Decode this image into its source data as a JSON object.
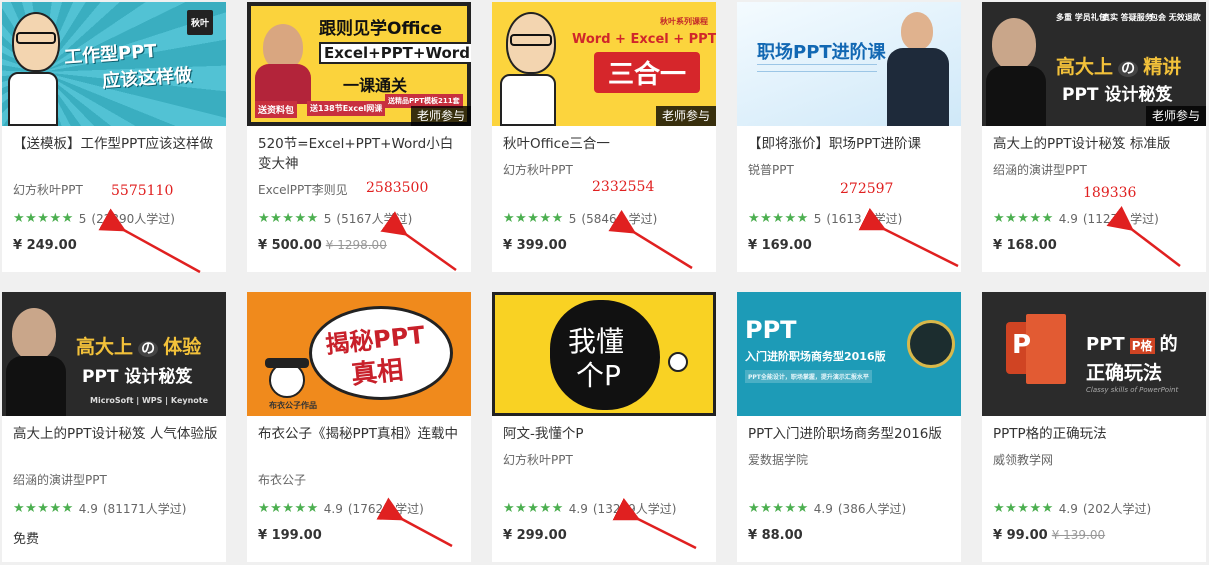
{
  "colors": {
    "star": "#4caf50",
    "annotation": "#e02020",
    "badge_bg": "#000000"
  },
  "cards": [
    {
      "title": "【送模板】工作型PPT应该这样做",
      "author": "幻方秋叶PPT",
      "stars": "★★★★★",
      "score": "5",
      "learners": "(22390人学过)",
      "price": "¥ 249.00",
      "old_price": "",
      "badge": "",
      "annotation": "5575110",
      "thumb": {
        "bg": "#3fb6c9",
        "line1": "工作型PPT",
        "line2": "应该这样做",
        "logo": "秋叶"
      }
    },
    {
      "title": "520节=Excel+PPT+Word小白变大神",
      "author": "ExcelPPT李则见",
      "stars": "★★★★★",
      "score": "5",
      "learners": "(5167人学过)",
      "price": "¥ 500.00",
      "old_price": "¥ 1298.00",
      "badge": "老师参与",
      "annotation": "2583500",
      "thumb": {
        "bg": "#fbd33c",
        "line1": "跟则见学Office",
        "line2": "Excel+PPT+Word",
        "line3": "一课通关",
        "tag1": "送资料包",
        "tag2": "送138节Excel网课",
        "tag3": "送精品PPT模板211套"
      }
    },
    {
      "title": "秋叶Office三合一",
      "author": "幻方秋叶PPT",
      "stars": "★★★★★",
      "score": "5",
      "learners": "(5846人学过)",
      "price": "¥ 399.00",
      "old_price": "",
      "badge": "老师参与",
      "annotation": "2332554",
      "thumb": {
        "bg": "#fcd43d",
        "line1": "Word + Excel + PPT",
        "line2": "三合一",
        "series": "秋叶系列课程"
      }
    },
    {
      "title": "【即将涨价】职场PPT进阶课",
      "author": "锐普PPT",
      "stars": "★★★★★",
      "score": "5",
      "learners": "(1613人学过)",
      "price": "¥ 169.00",
      "old_price": "",
      "badge": "",
      "annotation": "272597",
      "thumb": {
        "bg": "#e9f4fc",
        "line1": "职场PPT进阶课"
      }
    },
    {
      "title": "高大上的PPT设计秘笈 标准版",
      "author": "绍涵的演讲型PPT",
      "stars": "★★★★★",
      "score": "4.9",
      "learners": "(1127人学过)",
      "price": "¥ 168.00",
      "old_price": "",
      "badge": "老师参与",
      "annotation": "189336",
      "thumb": {
        "bg": "#2a2a2a",
        "line1": "高大上",
        "line1b": "の",
        "line1c": "精讲",
        "line2": "PPT 设计秘笈",
        "b1": "多重 学员礼包",
        "b2": "真实 答疑服务",
        "b3": "包会 无效退款"
      }
    },
    {
      "title": "高大上的PPT设计秘笈 人气体验版",
      "author": "绍涵的演讲型PPT",
      "stars": "★★★★★",
      "score": "4.9",
      "learners": "(81171人学过)",
      "price": "免费",
      "old_price": "",
      "badge": "",
      "annotation": "",
      "thumb": {
        "bg": "#2a2a2a",
        "line1": "高大上",
        "line1b": "の",
        "line1c": "体验",
        "line2": "PPT 设计秘笈",
        "footer": "MicroSoft | WPS | Keynote"
      }
    },
    {
      "title": "布衣公子《揭秘PPT真相》连载中",
      "author": "布衣公子",
      "stars": "★★★★★",
      "score": "4.9",
      "learners": "(1762人学过)",
      "price": "¥ 199.00",
      "old_price": "",
      "badge": "",
      "annotation": "",
      "thumb": {
        "bg": "#f08a1c",
        "line1": "揭秘PPT",
        "line2": "真相",
        "caption": "布衣公子作品"
      }
    },
    {
      "title": "阿文-我懂个P",
      "author": "幻方秋叶PPT",
      "stars": "★★★★★",
      "score": "4.9",
      "learners": "(13229人学过)",
      "price": "¥ 299.00",
      "old_price": "",
      "badge": "",
      "annotation": "",
      "thumb": {
        "bg": "#f9d223",
        "line1": "我懂",
        "line2": "个P"
      }
    },
    {
      "title": "PPT入门进阶职场商务型2016版",
      "author": "爱数据学院",
      "stars": "★★★★★",
      "score": "4.9",
      "learners": "(386人学过)",
      "price": "¥ 88.00",
      "old_price": "",
      "badge": "",
      "annotation": "",
      "thumb": {
        "bg": "#1d9bb7",
        "line1": "PPT",
        "line2": "入门进阶职场商务型2016版",
        "line3": "PPT全能设计，职场掌握，提升演示汇报水平"
      }
    },
    {
      "title": "PPTP格的正确玩法",
      "author": "威领教学网",
      "stars": "★★★★★",
      "score": "4.9",
      "learners": "(202人学过)",
      "price": "¥ 99.00",
      "old_price": "¥ 139.00",
      "badge": "",
      "annotation": "",
      "thumb": {
        "bg": "#2b2b2b",
        "line1": "PPT",
        "line1b": "P格",
        "line1c": "的",
        "line2": "正确玩法",
        "line3": "Classy skills of PowerPoint"
      }
    }
  ]
}
